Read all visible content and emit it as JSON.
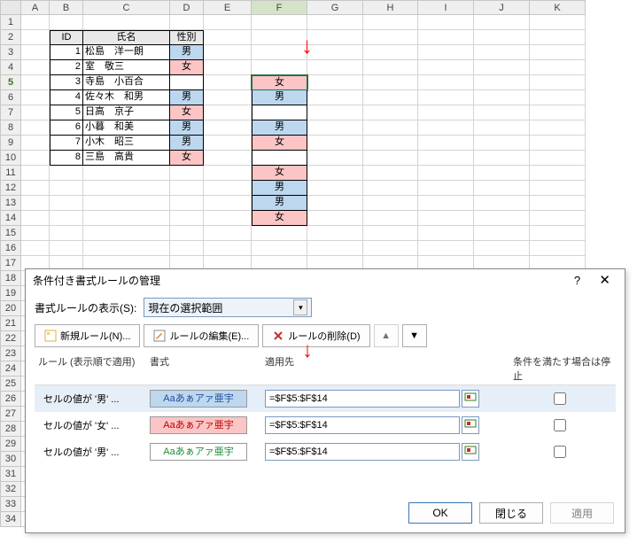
{
  "columns": [
    "A",
    "B",
    "C",
    "D",
    "E",
    "F",
    "G",
    "H",
    "I",
    "J",
    "K"
  ],
  "active_col": "F",
  "rows": 34,
  "active_row": 5,
  "table": {
    "headers": {
      "id": "ID",
      "name": "氏名",
      "gender": "性別"
    },
    "data": [
      {
        "id": "1",
        "name": "松島　洋一朗",
        "gender": "男",
        "cls": "blue"
      },
      {
        "id": "2",
        "name": "室　敬三",
        "gender": "女",
        "cls": "pink"
      },
      {
        "id": "3",
        "name": "寺島　小百合",
        "gender": "",
        "cls": ""
      },
      {
        "id": "4",
        "name": "佐々木　和男",
        "gender": "男",
        "cls": "blue"
      },
      {
        "id": "5",
        "name": "日高　京子",
        "gender": "女",
        "cls": "pink"
      },
      {
        "id": "6",
        "name": "小暮　和美",
        "gender": "男",
        "cls": "blue"
      },
      {
        "id": "7",
        "name": "小木　昭三",
        "gender": "男",
        "cls": "blue"
      },
      {
        "id": "8",
        "name": "三島　高貴",
        "gender": "女",
        "cls": "pink"
      }
    ]
  },
  "col_f": [
    {
      "v": "女",
      "cls": "pink",
      "active": true
    },
    {
      "v": "男",
      "cls": "blue"
    },
    {
      "v": "",
      "cls": ""
    },
    {
      "v": "男",
      "cls": "blue"
    },
    {
      "v": "女",
      "cls": "pink"
    },
    {
      "v": "",
      "cls": ""
    },
    {
      "v": "女",
      "cls": "pink"
    },
    {
      "v": "男",
      "cls": "blue"
    },
    {
      "v": "男",
      "cls": "blue"
    },
    {
      "v": "女",
      "cls": "pink"
    }
  ],
  "dialog": {
    "title": "条件付き書式ルールの管理",
    "scope_label": "書式ルールの表示(S):",
    "scope_value": "現在の選択範囲",
    "buttons": {
      "new": "新規ルール(N)...",
      "edit": "ルールの編集(E)...",
      "delete": "ルールの削除(D)"
    },
    "headers": {
      "rule": "ルール (表示順で適用)",
      "format": "書式",
      "apply": "適用先",
      "stop": "条件を満たす場合は停止"
    },
    "preview_text": "Aaあぁアァ亜宇",
    "rules": [
      {
        "label": "セルの値が '男' ...",
        "fmt": "blue",
        "range": "=$F$5:$F$14",
        "selected": true
      },
      {
        "label": "セルの値が '女' ...",
        "fmt": "pink",
        "range": "=$F$5:$F$14"
      },
      {
        "label": "セルの値が '男' ...",
        "fmt": "white",
        "range": "=$F$5:$F$14"
      }
    ],
    "footer": {
      "ok": "OK",
      "close": "閉じる",
      "apply": "適用"
    }
  }
}
